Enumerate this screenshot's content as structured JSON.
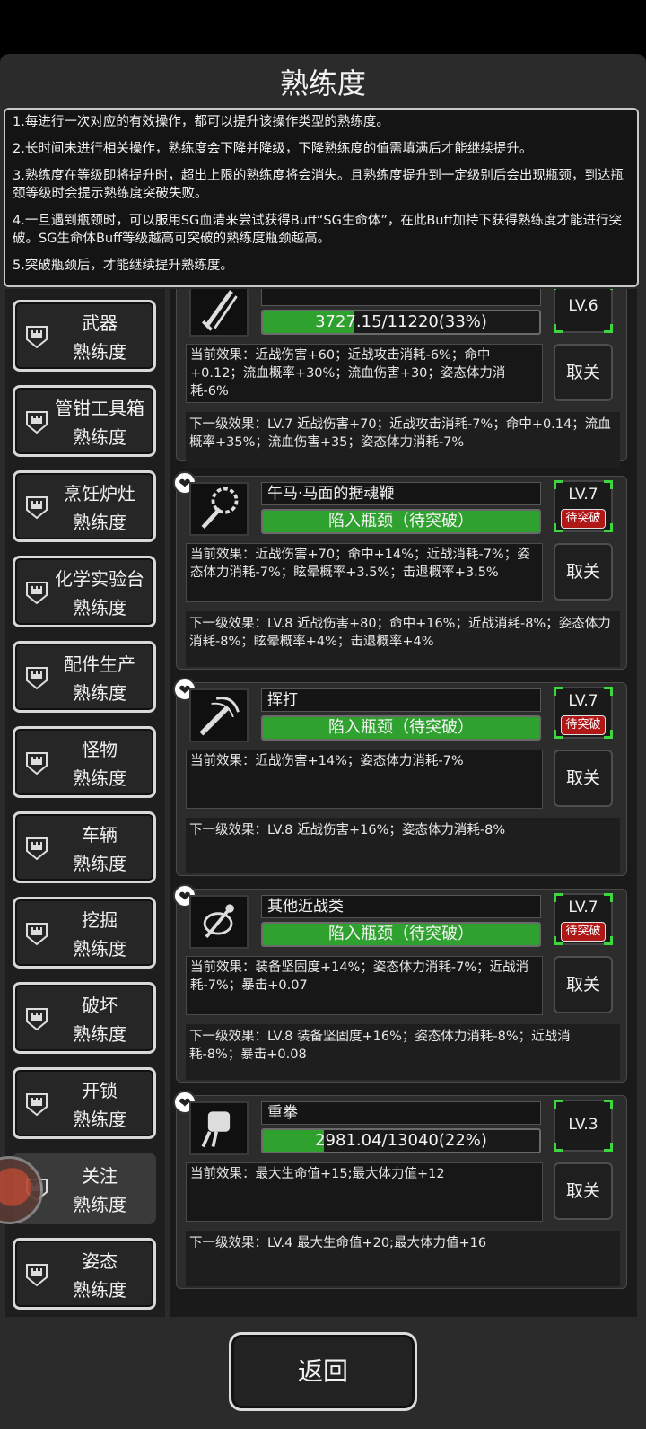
{
  "title": "熟练度",
  "info_lines": [
    "1.每进行一次对应的有效操作，都可以提升该操作类型的熟练度。",
    "2.长时间未进行相关操作，熟练度会下降并降级，下降熟练度的值需填满后才能继续提升。",
    "3.熟练度在等级即将提升时，超出上限的熟练度将会消失。且熟练度提升到一定级别后会出现瓶颈，到达瓶颈等级时会提示熟练度突破失败。",
    "4.一旦遇到瓶颈时，可以服用SG血清来尝试获得Buff“SG生命体”，在此Buff加持下获得熟练度才能进行突破。SG生命体Buff等级越高可突破的熟练度瓶颈越高。",
    "5.突破瓶颈后，才能继续提升熟练度。"
  ],
  "sidebar": {
    "items": [
      {
        "line1": "武器",
        "line2": "熟练度"
      },
      {
        "line1": "管钳工具箱",
        "line2": "熟练度"
      },
      {
        "line1": "烹饪炉灶",
        "line2": "熟练度"
      },
      {
        "line1": "化学实验台",
        "line2": "熟练度"
      },
      {
        "line1": "配件生产",
        "line2": "熟练度"
      },
      {
        "line1": "怪物",
        "line2": "熟练度"
      },
      {
        "line1": "车辆",
        "line2": "熟练度"
      },
      {
        "line1": "挖掘",
        "line2": "熟练度"
      },
      {
        "line1": "破坏",
        "line2": "熟练度"
      },
      {
        "line1": "开锁",
        "line2": "熟练度"
      },
      {
        "line1": "关注",
        "line2": "熟练度"
      },
      {
        "line1": "姿态",
        "line2": "熟练度"
      }
    ]
  },
  "cards": [
    {
      "name": "",
      "progress_text": "3727.15/11220(33%)",
      "progress": 0.33,
      "level": "LV.6",
      "badge": "",
      "current": "当前效果：近战伤害+60；近战攻击消耗-6%；命中+0.12；流血概率+30%；流血伤害+30；姿态体力消耗-6%",
      "next": "下一级效果：LV.7 近战伤害+70；近战攻击消耗-7%；命中+0.14；流血概率+35%；流血伤害+35；姿态体力消耗-7%",
      "cancel": "取关",
      "icon": "sword-icon"
    },
    {
      "name": "午马·马面的据魂鞭",
      "progress_text": "陷入瓶颈（待突破）",
      "progress": 1,
      "level": "LV.7",
      "badge": "待突破",
      "current": "当前效果：近战伤害+70；命中+14%；近战消耗-7%；姿态体力消耗-7%；眩晕概率+3.5%；击退概率+3.5%",
      "next": "下一级效果：LV.8 近战伤害+80；命中+16%；近战消耗-8%；姿态体力消耗-8%；眩晕概率+4%；击退概率+4%",
      "cancel": "取关",
      "icon": "whip-icon"
    },
    {
      "name": "挥打",
      "progress_text": "陷入瓶颈（待突破）",
      "progress": 1,
      "level": "LV.7",
      "badge": "待突破",
      "current": "当前效果：近战伤害+14%；姿态体力消耗-7%",
      "next": "下一级效果：LV.8 近战伤害+16%；姿态体力消耗-8%",
      "cancel": "取关",
      "icon": "swing-icon"
    },
    {
      "name": "其他近战类",
      "progress_text": "陷入瓶颈（待突破）",
      "progress": 1,
      "level": "LV.7",
      "badge": "待突破",
      "current": "当前效果：装备坚固度+14%；姿态体力消耗-7%；近战消耗-7%；暴击+0.07",
      "next": "下一级效果：LV.8 装备坚固度+16%；姿态体力消耗-8%；近战消耗-8%；暴击+0.08",
      "cancel": "取关",
      "icon": "misc-melee-icon"
    },
    {
      "name": "重拳",
      "progress_text": "2981.04/13040(22%)",
      "progress": 0.22,
      "level": "LV.3",
      "badge": "",
      "current": "当前效果：最大生命值+15;最大体力值+12",
      "next": "下一级效果：LV.4 最大生命值+20;最大体力值+16",
      "cancel": "取关",
      "icon": "fist-icon"
    }
  ],
  "back_label": "返回"
}
